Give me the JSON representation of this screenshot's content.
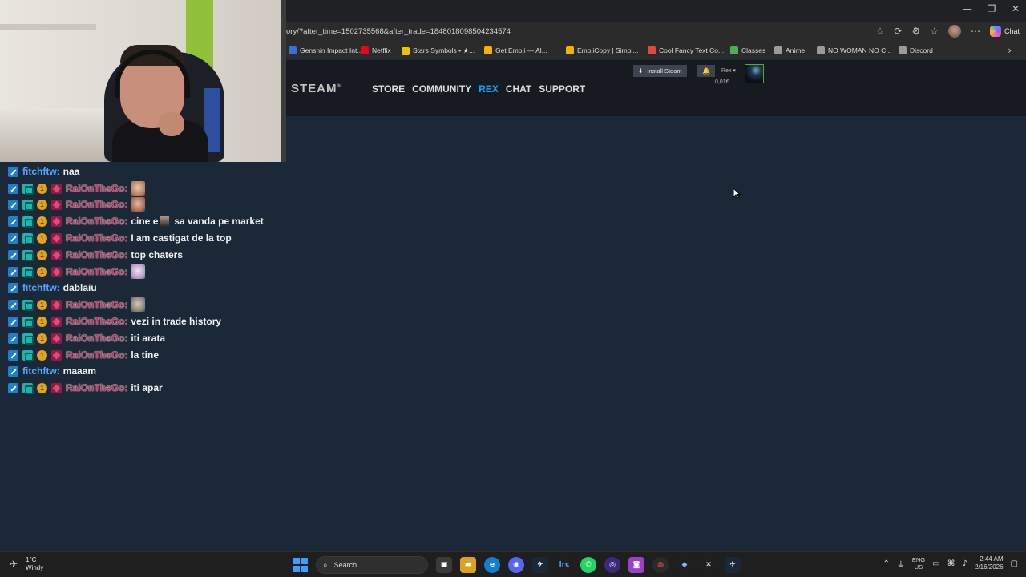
{
  "window": {
    "minimize": "—",
    "restore": "❐",
    "close": "✕"
  },
  "browser": {
    "url": "ory/?after_time=1502735568&after_trade=1848018098504234574",
    "copilot_label": "Chat",
    "bookmarks": [
      {
        "label": "Genshin Impact Int...",
        "color": "#3a6fd8"
      },
      {
        "label": "Netflix",
        "color": "#e50914"
      },
      {
        "label": "Stars Symbols • ★...",
        "color": "#f2c200"
      },
      {
        "label": "Get Emoji — Al...",
        "color": "#f2b400"
      },
      {
        "label": "EmojiCopy | Simpl...",
        "color": "#f2b400"
      },
      {
        "label": "Cool Fancy Text Co...",
        "color": "#e04a3a"
      },
      {
        "label": "Classes",
        "color": "#4caf50"
      },
      {
        "label": "Anime",
        "color": "#9a9a9a"
      },
      {
        "label": "NO WOMAN NO C...",
        "color": "#9a9a9a"
      },
      {
        "label": "Discord",
        "color": "#9a9a9a"
      }
    ]
  },
  "steam": {
    "logo": "STEAM",
    "nav": [
      "STORE",
      "COMMUNITY",
      "REX",
      "CHAT",
      "SUPPORT"
    ],
    "active_nav": "REX",
    "install_label": "Install Steam",
    "account_name": "Rex",
    "wallet": "0,01€"
  },
  "chat": {
    "messages": [
      {
        "user": "fitchftw",
        "text": "naa",
        "emote": null
      },
      {
        "user": "RaiOnTheGo",
        "text": "",
        "emote": "a"
      },
      {
        "user": "RaiOnTheGo",
        "text": "",
        "emote": "b"
      },
      {
        "user": "RaiOnTheGo",
        "text_before": "cine e",
        "text": "sa vanda pe market",
        "emote": "inline"
      },
      {
        "user": "RaiOnTheGo",
        "text": "I am castigat de la top",
        "emote": null
      },
      {
        "user": "RaiOnTheGo",
        "text": "top chaters",
        "emote": null
      },
      {
        "user": "RaiOnTheGo",
        "text": "",
        "emote": "c"
      },
      {
        "user": "fitchftw",
        "text": "dablaiu",
        "emote": null
      },
      {
        "user": "RaiOnTheGo",
        "text": "",
        "emote": "d"
      },
      {
        "user": "RaiOnTheGo",
        "text": "vezi in trade history",
        "emote": null
      },
      {
        "user": "RaiOnTheGo",
        "text": "iti arata",
        "emote": null
      },
      {
        "user": "RaiOnTheGo",
        "text": "la tine",
        "emote": null
      },
      {
        "user": "fitchftw",
        "text": "maaam",
        "emote": null
      },
      {
        "user": "RaiOnTheGo",
        "text": "iti apar",
        "emote": null
      }
    ]
  },
  "taskbar": {
    "temp": "1°C",
    "condition": "Windy",
    "search_placeholder": "Search",
    "lang_top": "ENG",
    "lang_bottom": "US",
    "time": "2:44 AM",
    "date": "2/16/2026"
  }
}
